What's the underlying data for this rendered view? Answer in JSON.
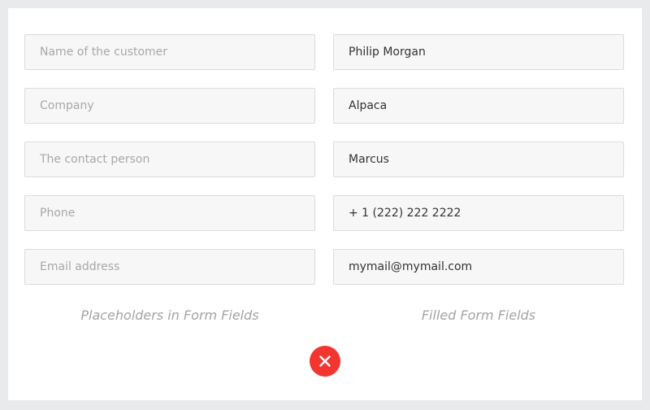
{
  "placeholder_fields": [
    {
      "placeholder": "Name of the customer"
    },
    {
      "placeholder": "Company"
    },
    {
      "placeholder": "The contact person"
    },
    {
      "placeholder": "Phone"
    },
    {
      "placeholder": "Email address"
    }
  ],
  "filled_fields": [
    {
      "value": "Philip Morgan"
    },
    {
      "value": "Alpaca"
    },
    {
      "value": "Marcus"
    },
    {
      "value": "+ 1 (222) 222 2222"
    },
    {
      "value": "mymail@mymail.com"
    }
  ],
  "captions": {
    "left": "Placeholders in Form Fields",
    "right": "Filled Form Fields"
  },
  "status": {
    "icon": "close-icon",
    "color": "#f2352e"
  },
  "colors": {
    "page_background": "#e9eaec",
    "card_background": "#ffffff",
    "field_background": "#f7f7f7",
    "field_border": "#dcdcdc",
    "placeholder_text": "#a8a8a8",
    "value_text": "#333333",
    "caption_text": "#a3a3a3"
  }
}
